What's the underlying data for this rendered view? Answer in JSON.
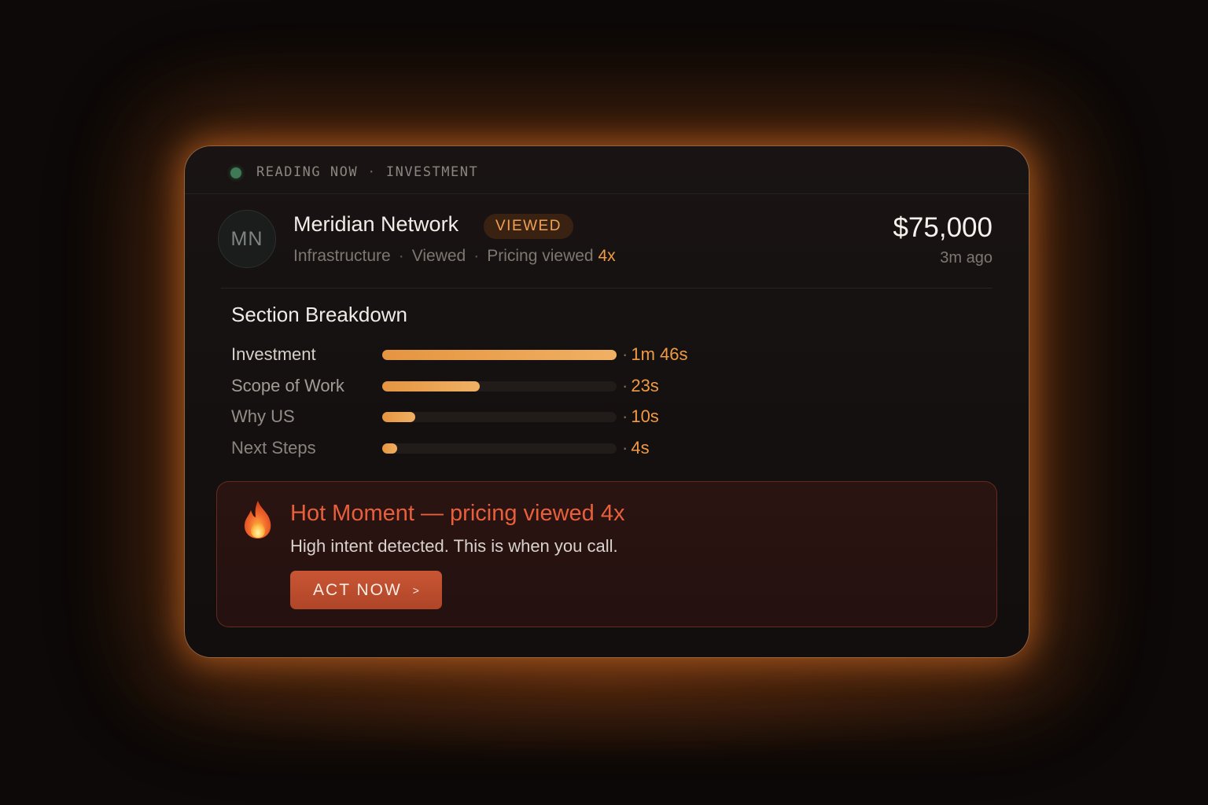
{
  "header": {
    "status": "READING NOW",
    "separator": "·",
    "section": "INVESTMENT",
    "status_color": "#3d7a55"
  },
  "prospect": {
    "initials": "MN",
    "name": "Meridian Network",
    "badge": "VIEWED",
    "category": "Infrastructure",
    "view_state": "Viewed",
    "pricing_label": "Pricing viewed",
    "pricing_count": "4x",
    "meta_separator": "·",
    "amount": "$75,000",
    "time_ago": "3m ago"
  },
  "breakdown": {
    "title": "Section Breakdown",
    "rows": [
      {
        "label": "Investment",
        "value": "1m 46s",
        "fraction": 1.0,
        "label_color": "#d6d0ca"
      },
      {
        "label": "Scope of Work",
        "value": "23s",
        "fraction": 0.415,
        "label_color": "#a39c96"
      },
      {
        "label": "Why US",
        "value": "10s",
        "fraction": 0.14,
        "label_color": "#948d87"
      },
      {
        "label": "Next Steps",
        "value": "4s",
        "fraction": 0.065,
        "label_color": "#8a837d"
      }
    ]
  },
  "hot_moment": {
    "icon": "fire-icon",
    "title": "Hot Moment — pricing viewed 4x",
    "subtitle": "High intent detected. This is when you call.",
    "button_label": "ACT NOW",
    "button_chevron": ">"
  },
  "colors": {
    "accent": "#f09a45",
    "hot": "#e85f3b",
    "button": "#c85634"
  }
}
